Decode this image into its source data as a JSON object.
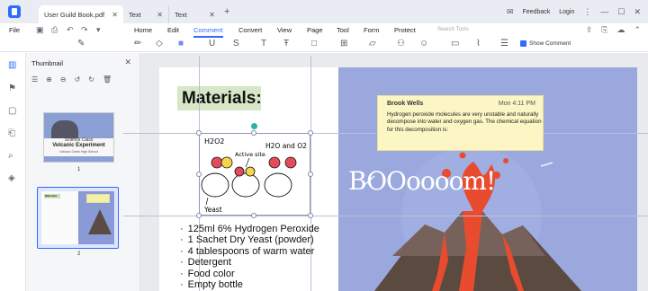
{
  "tabs": [
    {
      "label": "User Guild Book.pdf",
      "active": true
    },
    {
      "label": "Text",
      "active": false
    },
    {
      "label": "Text",
      "active": false
    }
  ],
  "titlebar": {
    "feedback": "Feedback",
    "login": "Login"
  },
  "menu": {
    "file": "File",
    "items": [
      "Home",
      "Edit",
      "Comment",
      "Convert",
      "View",
      "Page",
      "Tool",
      "Form",
      "Protect"
    ],
    "active": "Comment",
    "search_placeholder": "Search Tools"
  },
  "toolbar": {
    "show_comment": "Show Comment",
    "show_comment_checked": true
  },
  "thumbnail_panel": {
    "title": "Thumbnail",
    "pages": [
      {
        "number": "1",
        "lines": [
          "Science Class",
          "Volcanic Experiment",
          "Volcano Creek High School"
        ]
      },
      {
        "number": "2",
        "selected": true,
        "title": "Materials:"
      }
    ]
  },
  "document": {
    "heading": "Materials:",
    "diagram_labels": [
      "H2O2",
      "H2O and O2",
      "Active site",
      "Yeast"
    ],
    "materials": [
      "125ml 6% Hydrogen Peroxide",
      "1 Sachet Dry Yeast (powder)",
      "4 tablespoons of warm water",
      "Detergent",
      "Food color",
      "Empty bottle"
    ],
    "comment": {
      "author": "Brook Wells",
      "time": "Mon 4:11 PM",
      "text": "Hydrogen peroxide molecules are very unstable and naturally decompose into water and oxygen gas. The chemical equation for this decomposition is:"
    },
    "illustration_text": "BOOoooom!"
  },
  "colors": {
    "accent": "#2f6bff",
    "note": "#fbf6c4",
    "page_right": "#9aa8de",
    "heading_bg": "#d7e6c6"
  }
}
